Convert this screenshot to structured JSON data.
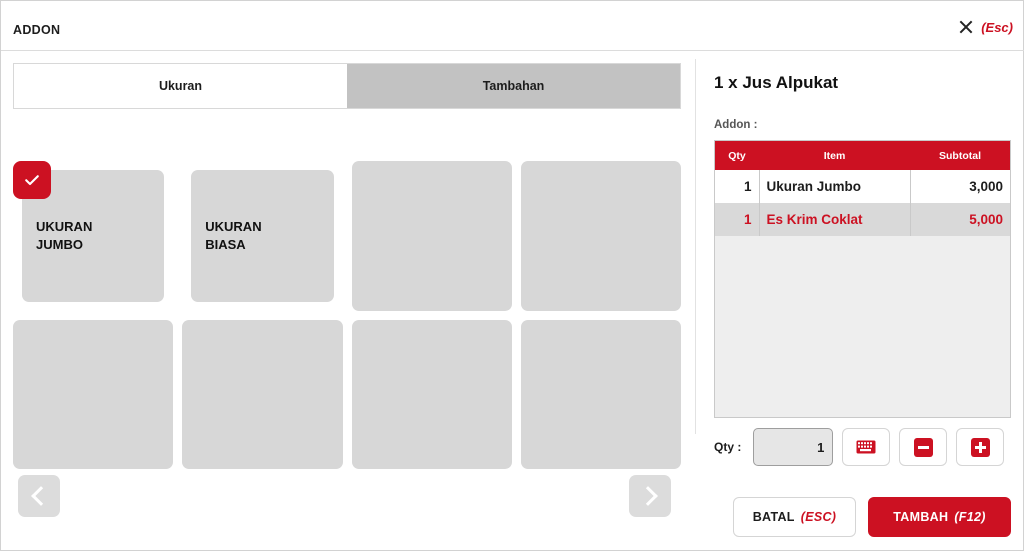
{
  "header": {
    "title": "ADDON",
    "close_icon": "close-icon",
    "close_hint": "(Esc)"
  },
  "tabs": [
    {
      "label": "Ukuran",
      "active": true
    },
    {
      "label": "Tambahan",
      "active": false
    }
  ],
  "grid": {
    "tiles": [
      {
        "label": "UKURAN\nJUMBO",
        "filled": true,
        "selected": true
      },
      {
        "label": "UKURAN\nBIASA",
        "filled": true,
        "selected": false
      },
      {
        "label": "",
        "filled": false,
        "selected": false
      },
      {
        "label": "",
        "filled": false,
        "selected": false
      },
      {
        "label": "",
        "filled": false,
        "selected": false
      },
      {
        "label": "",
        "filled": false,
        "selected": false
      },
      {
        "label": "",
        "filled": false,
        "selected": false
      },
      {
        "label": "",
        "filled": false,
        "selected": false
      }
    ],
    "prev_icon": "chevron-left-icon",
    "next_icon": "chevron-right-icon"
  },
  "detail": {
    "product_title": "1 x Jus Alpukat",
    "addon_label": "Addon :",
    "table": {
      "columns": [
        "Qty",
        "Item",
        "Subtotal"
      ],
      "rows": [
        {
          "qty": "1",
          "item": "Ukuran Jumbo",
          "subtotal": "3,000",
          "highlighted": false
        },
        {
          "qty": "1",
          "item": "Es Krim Coklat",
          "subtotal": "5,000",
          "highlighted": true
        }
      ]
    },
    "qty": {
      "label": "Qty :",
      "value": "1",
      "placeholder": "0",
      "keyboard_icon": "keyboard-icon",
      "minus_icon": "minus-icon",
      "plus_icon": "plus-icon"
    }
  },
  "footer": {
    "cancel_label": "BATAL",
    "cancel_key": "(ESC)",
    "add_label": "TAMBAH",
    "add_key": "(F12)"
  },
  "colors": {
    "accent_red": "#cc1122",
    "tile_gray": "#d7d7d7",
    "tab_inactive": "#c2c2c2",
    "row_alt": "#d9d9d9"
  }
}
